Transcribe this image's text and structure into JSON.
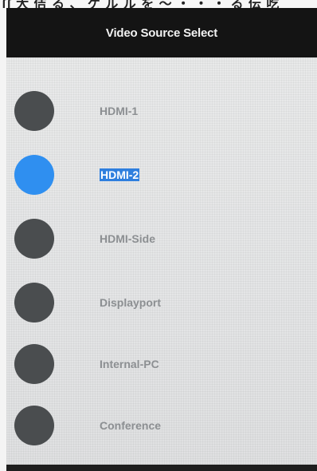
{
  "top_strip": {
    "text": "ʃʃ ⼤ 佶 る 、 ケ ル ル を 〜 ・ ・ ・ る 伝 吃"
  },
  "header": {
    "title": "Video Source Select"
  },
  "sources": [
    {
      "label": "HDMI-1",
      "selected": false
    },
    {
      "label": "HDMI-2",
      "selected": true
    },
    {
      "label": "HDMI-Side",
      "selected": false
    },
    {
      "label": "Displayport",
      "selected": false
    },
    {
      "label": "Internal-PC",
      "selected": false
    },
    {
      "label": "Conference",
      "selected": false
    }
  ],
  "colors": {
    "title_bar": "#141414",
    "selected_radio": "#2f8ff0",
    "unselected_radio": "#4a4d4f",
    "selection_highlight": "#2f7fde"
  }
}
